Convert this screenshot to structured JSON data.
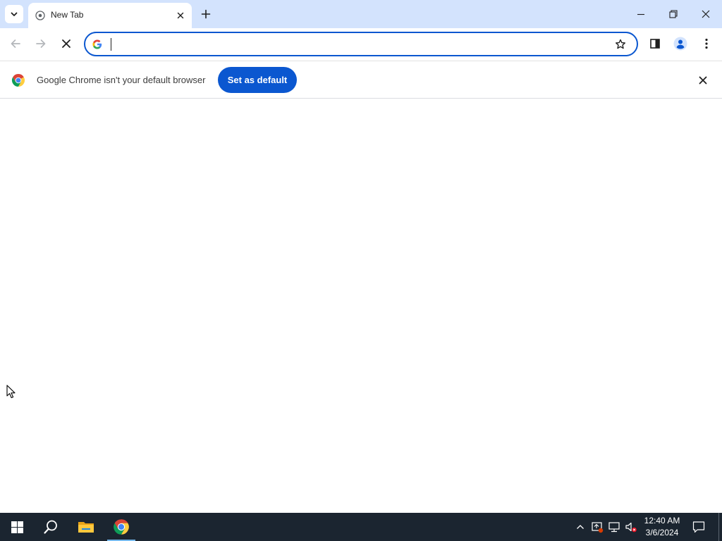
{
  "browser": {
    "tab": {
      "title": "New Tab"
    },
    "omnibox": {
      "value": "",
      "placeholder": ""
    }
  },
  "infobar": {
    "message": "Google Chrome isn't your default browser",
    "button_label": "Set as default"
  },
  "taskbar": {
    "clock_time": "12:40 AM",
    "clock_date": "3/6/2024"
  },
  "icons": {
    "tab_search": "chevron-down-icon",
    "tab_favicon": "globe-icon",
    "tab_close": "close-icon",
    "new_tab": "plus-icon",
    "minimize": "minimize-icon",
    "restore": "restore-icon",
    "close_window": "close-icon",
    "back": "arrow-left-icon",
    "forward": "arrow-right-icon",
    "stop": "close-icon",
    "omnibox_google": "google-g-icon",
    "bookmark": "star-icon",
    "side_panel": "side-panel-icon",
    "profile": "person-icon",
    "menu": "kebab-menu-icon",
    "infobar_logo": "chrome-logo-icon",
    "infobar_close": "close-icon",
    "start": "windows-logo-icon",
    "search": "search-icon",
    "file_explorer": "folder-icon",
    "chrome": "chrome-logo-icon",
    "tray_chevron": "chevron-up-icon",
    "tray_security": "shield-icon",
    "tray_network": "network-icon",
    "tray_volume": "volume-muted-icon",
    "notifications": "notification-icon"
  },
  "colors": {
    "accent": "#0b57d0",
    "tabstrip": "#d3e3fd",
    "taskbar": "#1b2530"
  }
}
